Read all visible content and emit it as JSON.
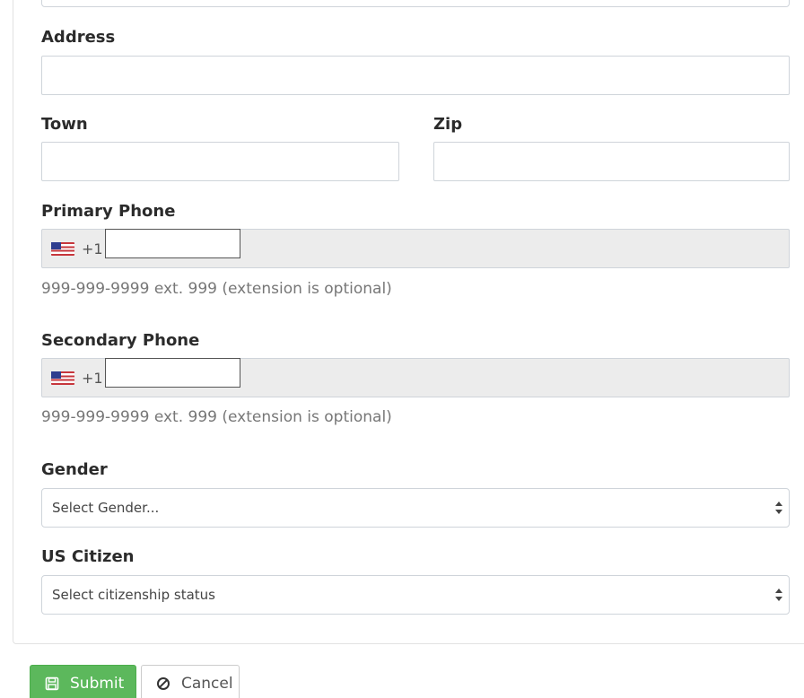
{
  "form": {
    "address": {
      "label": "Address",
      "value": ""
    },
    "town": {
      "label": "Town",
      "value": ""
    },
    "zip": {
      "label": "Zip",
      "value": ""
    },
    "primary_phone": {
      "label": "Primary Phone",
      "dial_code": "+1",
      "value": "",
      "help": "999-999-9999 ext. 999 (extension is optional)"
    },
    "secondary_phone": {
      "label": "Secondary Phone",
      "dial_code": "+1",
      "value": "",
      "help": "999-999-9999 ext. 999 (extension is optional)"
    },
    "gender": {
      "label": "Gender",
      "selected": "Select Gender..."
    },
    "us_citizen": {
      "label": "US Citizen",
      "selected": "Select citizenship status"
    }
  },
  "actions": {
    "submit_label": "Submit",
    "cancel_label": "Cancel"
  },
  "icons": {
    "flag": "us-flag-icon",
    "submit": "floppy-disk-icon",
    "cancel": "ban-icon",
    "select": "sort-arrows-icon"
  },
  "colors": {
    "submit_bg": "#5cb85c",
    "phone_bg": "#ececec",
    "label": "#2b2b2b",
    "help": "#777777"
  }
}
